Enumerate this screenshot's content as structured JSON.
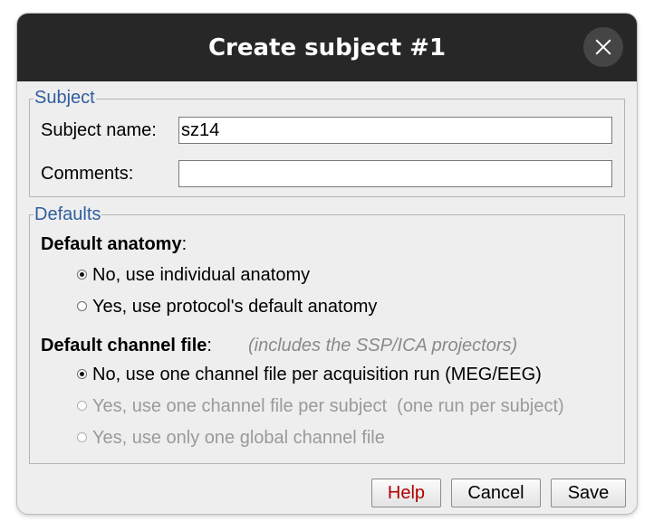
{
  "window": {
    "title": "Create subject #1"
  },
  "subject_group": {
    "legend": "Subject",
    "name_label": "Subject name:",
    "name_value": "sz14",
    "comments_label": "Comments:",
    "comments_value": ""
  },
  "defaults_group": {
    "legend": "Defaults",
    "anatomy": {
      "heading": "Default anatomy",
      "colon": ":",
      "options": [
        {
          "label": "No, use individual anatomy",
          "selected": true,
          "enabled": true
        },
        {
          "label": "Yes, use protocol's default anatomy",
          "selected": false,
          "enabled": true
        }
      ]
    },
    "channel": {
      "heading": "Default channel file",
      "colon": ":",
      "hint": "(includes the SSP/ICA projectors)",
      "options": [
        {
          "label": "No, use one channel file per acquisition run (MEG/EEG)",
          "selected": true,
          "enabled": true
        },
        {
          "label": "Yes, use one channel file per subject  (one run per subject)",
          "selected": false,
          "enabled": false
        },
        {
          "label": "Yes, use only one global channel file",
          "selected": false,
          "enabled": false
        }
      ]
    }
  },
  "buttons": {
    "help": "Help",
    "cancel": "Cancel",
    "save": "Save"
  },
  "colors": {
    "titlebar": "#272727",
    "legend_text": "#2f5e9e",
    "help_text": "#b00000",
    "dialog_bg": "#eeeeee"
  },
  "icons": {
    "close": "close-icon"
  }
}
